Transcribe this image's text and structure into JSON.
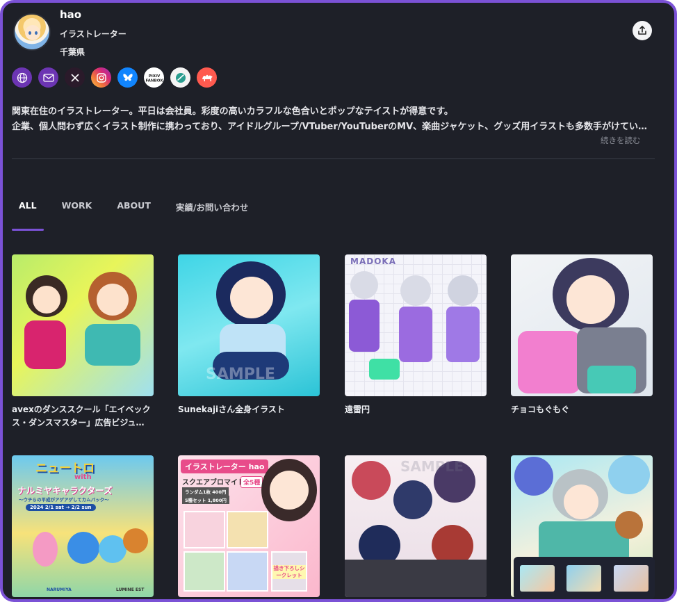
{
  "profile": {
    "name": "hao",
    "title": "イラストレーター",
    "location": "千葉県"
  },
  "social_links": [
    {
      "icon": "globe-icon",
      "bg": "#6c35b3",
      "fg": "#ffffff"
    },
    {
      "icon": "mail-icon",
      "bg": "#6c35b3",
      "fg": "#ffffff"
    },
    {
      "icon": "x-icon",
      "bg": "#2a1a2a",
      "fg": "#ffffff"
    },
    {
      "icon": "instagram-icon",
      "bg": "#f0743a",
      "fg": "#ffffff"
    },
    {
      "icon": "bluesky-icon",
      "bg": "#1185fe",
      "fg": "#ffffff"
    },
    {
      "icon": "pixiv-fanbox-icon",
      "bg": "#ffffff",
      "fg": "#222222",
      "text": "PIXIV\nFANBOX"
    },
    {
      "icon": "skeb-icon",
      "bg": "#f4f4f4",
      "fg": "#2a9d8f"
    },
    {
      "icon": "camel-icon",
      "bg": "#ff5a4f",
      "fg": "#ffffff"
    }
  ],
  "bio": {
    "line1": "関東在住のイラストレーター。平日は会社員。彩度の高いカラフルな色合いとポップなテイストが得意です。",
    "line2": "企業、個人問わず広くイラスト制作に携わっており、アイドルグループ/VTuber/YouTuberのMV、楽曲ジャケット、グッズ用イラストも多数手がけています。",
    "read_more": "続きを読む"
  },
  "tabs": [
    {
      "label": "ALL",
      "active": true
    },
    {
      "label": "WORK",
      "active": false
    },
    {
      "label": "ABOUT",
      "active": false
    },
    {
      "label": "実績/お問い合わせ",
      "active": false
    }
  ],
  "works": [
    {
      "caption": "avexのダンススクール「エイベックス・ダンスマスター」広告ビジュ…"
    },
    {
      "caption": "Sunekajiさん全身イラスト"
    },
    {
      "caption": "遠雷円"
    },
    {
      "caption": "チョコもぐもぐ"
    },
    {
      "caption": ""
    },
    {
      "caption": ""
    },
    {
      "caption": ""
    },
    {
      "caption": ""
    }
  ],
  "thumb_texts": {
    "madoka": "MADOKA",
    "nyuutoro": "ニュートロ",
    "with": "with",
    "event": "ナルミヤキャラクターズ",
    "event_sub": "〜ウチらの平成がアゲアゲしてカムバック〜",
    "dates": "2024 2/1 sat → 2/2 sun",
    "narumiya": "NARUMIYA",
    "lumine": "LUMINE EST",
    "hao_banner": "イラストレーター hao",
    "square_bromide": "スクエアブロマイド",
    "kinds": "全5種",
    "price1": "ランダム1枚 400円",
    "price2": "5種セット 1,800円",
    "secret": "描き下ろしシークレット",
    "sample": "SAMPLE"
  },
  "accent_color": "#7b52d6"
}
